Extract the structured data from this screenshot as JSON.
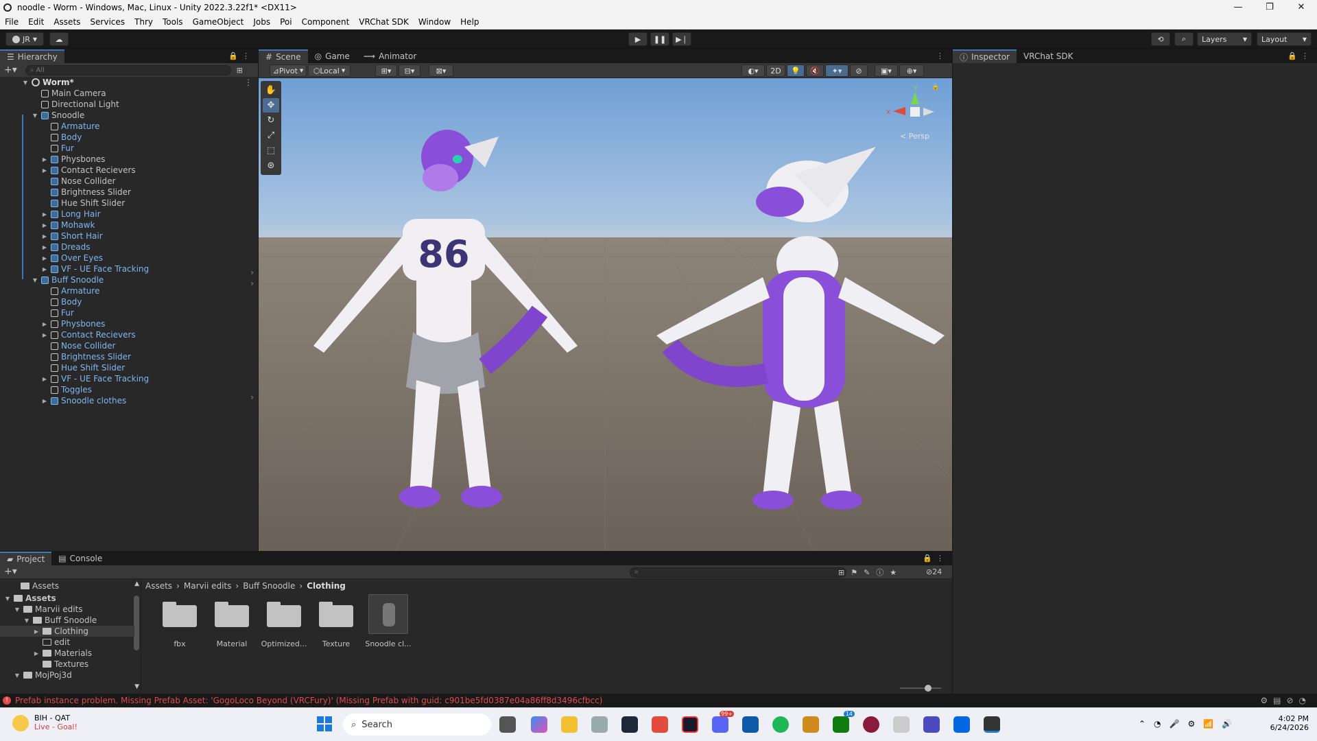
{
  "window": {
    "title": "noodle - Worm - Windows, Mac, Linux - Unity 2022.3.22f1* <DX11>"
  },
  "menu": [
    "File",
    "Edit",
    "Assets",
    "Services",
    "Thry",
    "Tools",
    "GameObject",
    "Jobs",
    "Poi",
    "Component",
    "VRChat SDK",
    "Window",
    "Help"
  ],
  "toolbar": {
    "account": "JR",
    "layers": "Layers",
    "layout": "Layout"
  },
  "hierarchy": {
    "tab": "Hierarchy",
    "search_placeholder": "All",
    "scene": "Worm*",
    "items": [
      {
        "label": "Main Camera",
        "depth": 1,
        "prefab": false,
        "arrow": ""
      },
      {
        "label": "Directional Light",
        "depth": 1,
        "prefab": false,
        "arrow": ""
      },
      {
        "label": "Snoodle",
        "depth": 1,
        "prefab": true,
        "arrow": "down"
      },
      {
        "label": "Armature",
        "depth": 2,
        "prefab": false,
        "arrow": "",
        "blue": true
      },
      {
        "label": "Body",
        "depth": 2,
        "prefab": false,
        "arrow": "",
        "blue": true
      },
      {
        "label": "Fur",
        "depth": 2,
        "prefab": false,
        "arrow": "",
        "blue": true
      },
      {
        "label": "Physbones",
        "depth": 2,
        "prefab": true,
        "arrow": "right"
      },
      {
        "label": "Contact Recievers",
        "depth": 2,
        "prefab": true,
        "arrow": "right"
      },
      {
        "label": "Nose Collider",
        "depth": 2,
        "prefab": true,
        "arrow": ""
      },
      {
        "label": "Brightness Slider",
        "depth": 2,
        "prefab": true,
        "arrow": ""
      },
      {
        "label": "Hue Shift Slider",
        "depth": 2,
        "prefab": true,
        "arrow": ""
      },
      {
        "label": "Long Hair",
        "depth": 2,
        "prefab": true,
        "arrow": "right",
        "blue": true
      },
      {
        "label": "Mohawk",
        "depth": 2,
        "prefab": true,
        "arrow": "right",
        "blue": true
      },
      {
        "label": "Short Hair",
        "depth": 2,
        "prefab": true,
        "arrow": "right",
        "blue": true
      },
      {
        "label": "Dreads",
        "depth": 2,
        "prefab": true,
        "arrow": "right",
        "blue": true
      },
      {
        "label": "Over Eyes",
        "depth": 2,
        "prefab": true,
        "arrow": "right",
        "blue": true
      },
      {
        "label": "VF - UE Face Tracking",
        "depth": 2,
        "prefab": true,
        "arrow": "right",
        "blue": true
      },
      {
        "label": "Buff Snoodle",
        "depth": 1,
        "prefab": true,
        "arrow": "down",
        "blue": true
      },
      {
        "label": "Armature",
        "depth": 2,
        "prefab": false,
        "arrow": "",
        "blue": true
      },
      {
        "label": "Body",
        "depth": 2,
        "prefab": false,
        "arrow": "",
        "blue": true
      },
      {
        "label": "Fur",
        "depth": 2,
        "prefab": false,
        "arrow": "",
        "blue": true
      },
      {
        "label": "Physbones",
        "depth": 2,
        "prefab": false,
        "arrow": "right",
        "blue": true
      },
      {
        "label": "Contact Recievers",
        "depth": 2,
        "prefab": false,
        "arrow": "right",
        "blue": true
      },
      {
        "label": "Nose Collider",
        "depth": 2,
        "prefab": false,
        "arrow": "",
        "blue": true
      },
      {
        "label": "Brightness Slider",
        "depth": 2,
        "prefab": false,
        "arrow": "",
        "blue": true
      },
      {
        "label": "Hue Shift Slider",
        "depth": 2,
        "prefab": false,
        "arrow": "",
        "blue": true
      },
      {
        "label": "VF - UE Face Tracking",
        "depth": 2,
        "prefab": false,
        "arrow": "right",
        "blue": true
      },
      {
        "label": "Toggles",
        "depth": 2,
        "prefab": false,
        "arrow": "",
        "blue": true
      },
      {
        "label": "Snoodle clothes",
        "depth": 2,
        "prefab": true,
        "arrow": "right",
        "blue": true
      }
    ]
  },
  "scene": {
    "tabs": [
      "Scene",
      "Game",
      "Animator"
    ],
    "pivot": "Pivot",
    "local": "Local",
    "mode2d": "2D",
    "persp": "< Persp",
    "gizmo_y": "y",
    "gizmo_x": "x",
    "jersey_number": "86"
  },
  "inspector": {
    "tabs": [
      "Inspector",
      "VRChat SDK"
    ]
  },
  "project": {
    "tabs": [
      "Project",
      "Console"
    ],
    "favorites_label": "Assets",
    "tree": [
      {
        "label": "Assets",
        "depth": 0,
        "arrow": "down",
        "bold": true
      },
      {
        "label": "Marvii edits",
        "depth": 1,
        "arrow": "down"
      },
      {
        "label": "Buff Snoodle",
        "depth": 2,
        "arrow": "down"
      },
      {
        "label": "Clothing",
        "depth": 3,
        "arrow": "right",
        "selected": true
      },
      {
        "label": "edit",
        "depth": 3,
        "arrow": ""
      },
      {
        "label": "Materials",
        "depth": 3,
        "arrow": "right"
      },
      {
        "label": "Textures",
        "depth": 3,
        "arrow": ""
      },
      {
        "label": "MojPoj3d",
        "depth": 1,
        "arrow": "down"
      }
    ],
    "breadcrumb": [
      "Assets",
      "Marvii edits",
      "Buff Snoodle",
      "Clothing"
    ],
    "hidden_count": "24",
    "assets": [
      {
        "label": "fbx",
        "type": "folder"
      },
      {
        "label": "Material",
        "type": "folder"
      },
      {
        "label": "Optimized...",
        "type": "folder"
      },
      {
        "label": "Texture",
        "type": "folder"
      },
      {
        "label": "Snoodle cl...",
        "type": "prefab"
      }
    ]
  },
  "status": {
    "message": "Prefab instance problem. Missing Prefab Asset: 'GogoLoco Beyond (VRCFury)' (Missing Prefab with guid: c901be5fd0387e04a86ff8d3496cfbcc)"
  },
  "taskbar": {
    "weather_title": "BIH - QAT",
    "weather_sub": "Live - Goal!",
    "search": "Search",
    "time": "4:02 PM",
    "date": "6/24/2026",
    "discord_badge": "99+",
    "xbox_badge": "14"
  }
}
